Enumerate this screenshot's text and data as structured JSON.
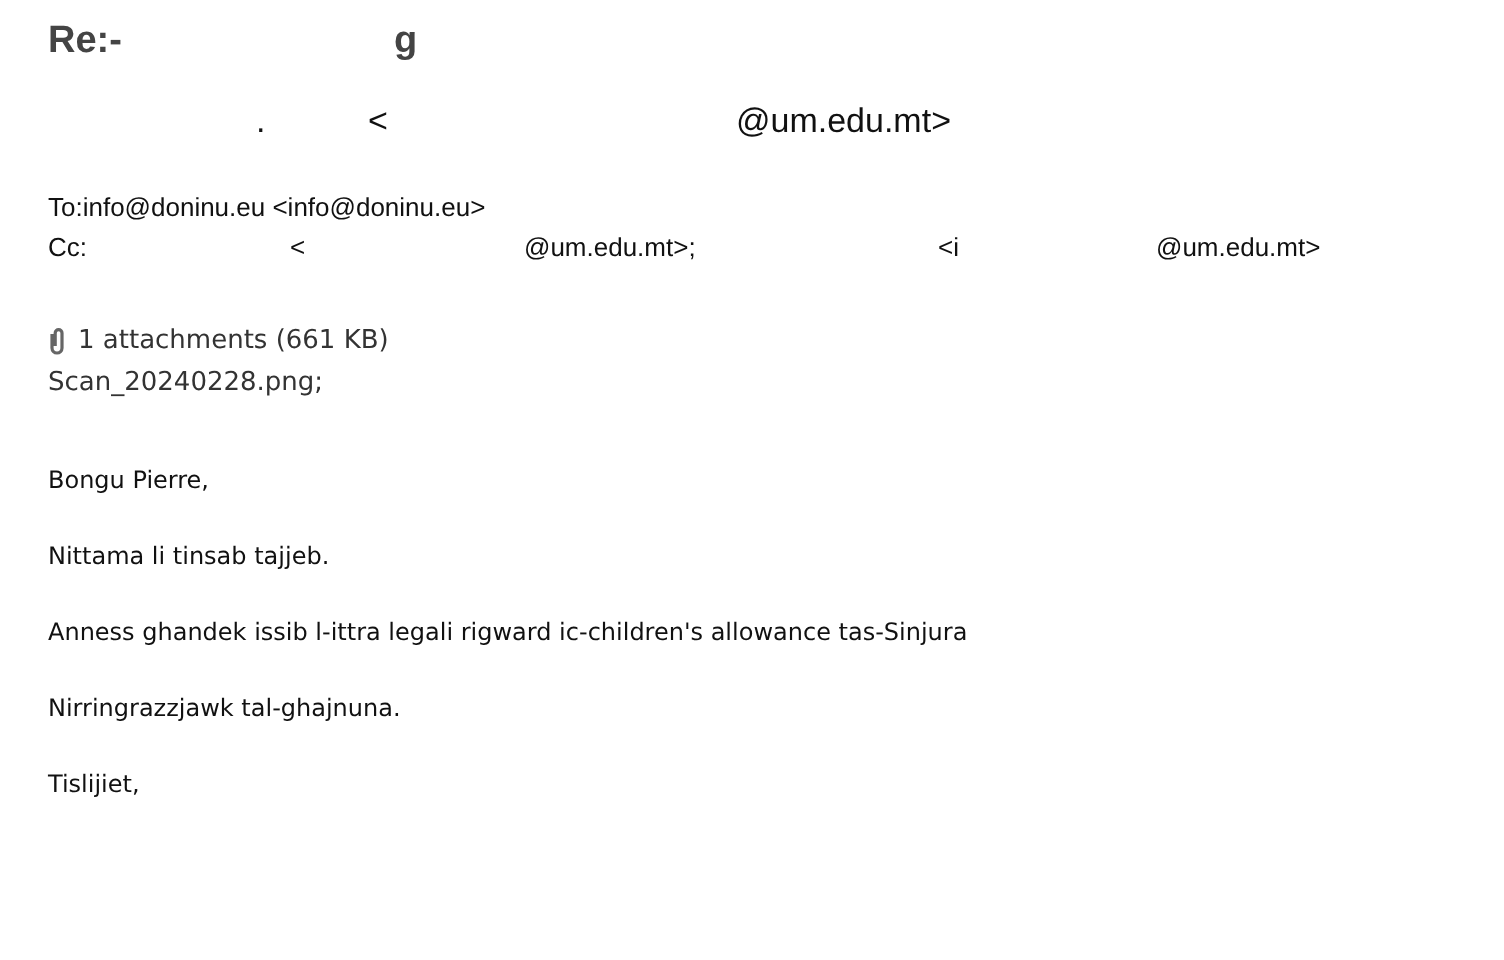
{
  "subject": {
    "parts": [
      "Re:-",
      "g"
    ]
  },
  "sender": {
    "parts": [
      ".",
      "<",
      "@um.edu.mt>"
    ]
  },
  "to": "To:info@doninu.eu  <info@doninu.eu>",
  "cc": {
    "parts": [
      "Cc:",
      "<",
      "@um.edu.mt>;",
      "<i",
      "@um.edu.mt>"
    ]
  },
  "attachments": {
    "summary": "1 attachments (661 KB)",
    "files": [
      "Scan_20240228.png;"
    ]
  },
  "body": [
    "Bongu Pierre,",
    "Nittama li tinsab tajjeb.",
    "Anness ghandek issib l-ittra legali rigward ic-children's allowance tas-Sinjura",
    "Nirringrazzjawk tal-ghajnuna.",
    "Tislijiet,"
  ]
}
